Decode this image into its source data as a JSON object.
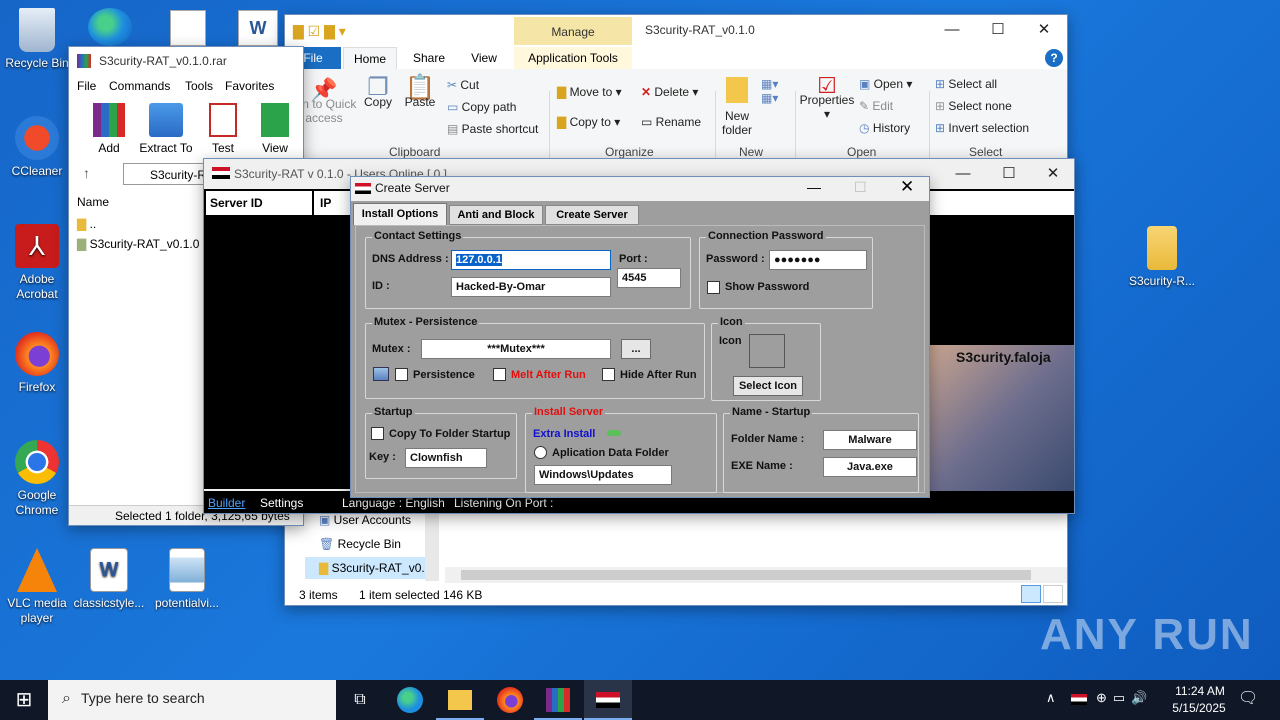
{
  "desktop": {
    "icons": [
      {
        "label": "Recycle Bin"
      },
      {
        "label": "CCleaner"
      },
      {
        "label": "Adobe Acrobat"
      },
      {
        "label": "Firefox"
      },
      {
        "label": "Google Chrome"
      },
      {
        "label": "VLC media player"
      },
      {
        "label": "classicstyle..."
      },
      {
        "label": "potentialvi..."
      },
      {
        "label": "S3curity-R..."
      }
    ]
  },
  "explorer": {
    "title": "S3curity-RAT_v0.1.0",
    "manage_tab": "Manage",
    "tabs": [
      "File",
      "Home",
      "Share",
      "View",
      "Application Tools"
    ],
    "ribbon": {
      "pin": "Pin to Quick access",
      "copy": "Copy",
      "paste": "Paste",
      "cut": "Cut",
      "copy_path": "Copy path",
      "paste_shortcut": "Paste shortcut",
      "move_to": "Move to",
      "copy_to": "Copy to",
      "delete": "Delete",
      "rename": "Rename",
      "new_folder": "New folder",
      "properties": "Properties",
      "open": "Open",
      "edit": "Edit",
      "history": "History",
      "select_all": "Select all",
      "select_none": "Select none",
      "invert_selection": "Invert selection"
    },
    "groups": [
      "Clipboard",
      "Organize",
      "New",
      "Open",
      "Select"
    ],
    "nav": [
      "User Accounts",
      "Recycle Bin",
      "S3curity-RAT_v0."
    ],
    "status": {
      "items": "3 items",
      "selected": "1 item selected",
      "size": "146 KB"
    }
  },
  "winrar": {
    "title": "S3curity-RAT_v0.1.0.rar",
    "menu": [
      "File",
      "Commands",
      "Tools",
      "Favorites"
    ],
    "tools": [
      "Add",
      "Extract To",
      "Test",
      "View"
    ],
    "path": "S3curity-R",
    "col_name": "Name",
    "files": [
      "..",
      "S3curity-RAT_v0.1.0"
    ],
    "status": "Selected 1 folder, 3,125,65 bytes"
  },
  "rat": {
    "title": "S3curity-RAT v 0.1.0 - Users Online [ 0 ]",
    "columns": [
      "Server ID",
      "IP"
    ],
    "banner": "S3curity.faloja",
    "bottom": [
      "Builder",
      "Settings",
      "Language : English",
      "Listening On Port :"
    ]
  },
  "dialog": {
    "title": "Create Server",
    "tabs": [
      "Install Options",
      "Anti and Block",
      "Create Server"
    ],
    "contact": {
      "legend": "Contact Settings",
      "dns_label": "DNS Address :",
      "dns_value": "127.0.0.1",
      "port_label": "Port :",
      "port_value": "4545",
      "id_label": "ID :",
      "id_value": "Hacked-By-Omar"
    },
    "password": {
      "legend": "Connection Password",
      "label": "Password :",
      "value": "●●●●●●●",
      "show": "Show Password"
    },
    "mutex": {
      "legend": "Mutex - Persistence",
      "label": "Mutex :",
      "value": "***Mutex***",
      "browse": "...",
      "persistence": "Persistence",
      "melt": "Melt After Run",
      "hide": "Hide After Run"
    },
    "icon": {
      "legend": "Icon",
      "label": "Icon",
      "button": "Select Icon"
    },
    "startup": {
      "legend": "Startup",
      "copy": "Copy To Folder Startup",
      "key_label": "Key :",
      "key_value": "Clownfish"
    },
    "install": {
      "legend": "Install Server",
      "extra": "Extra Install",
      "option": "Aplication Data Folder",
      "path": "Windows\\Updates"
    },
    "name_startup": {
      "legend": "Name - Startup",
      "folder_label": "Folder Name :",
      "folder_value": "Malware",
      "exe_label": "EXE Name :",
      "exe_value": "Java.exe"
    }
  },
  "taskbar": {
    "search_placeholder": "Type here to search",
    "time": "11:24 AM",
    "date": "5/15/2025"
  },
  "watermark": "ANY RUN"
}
